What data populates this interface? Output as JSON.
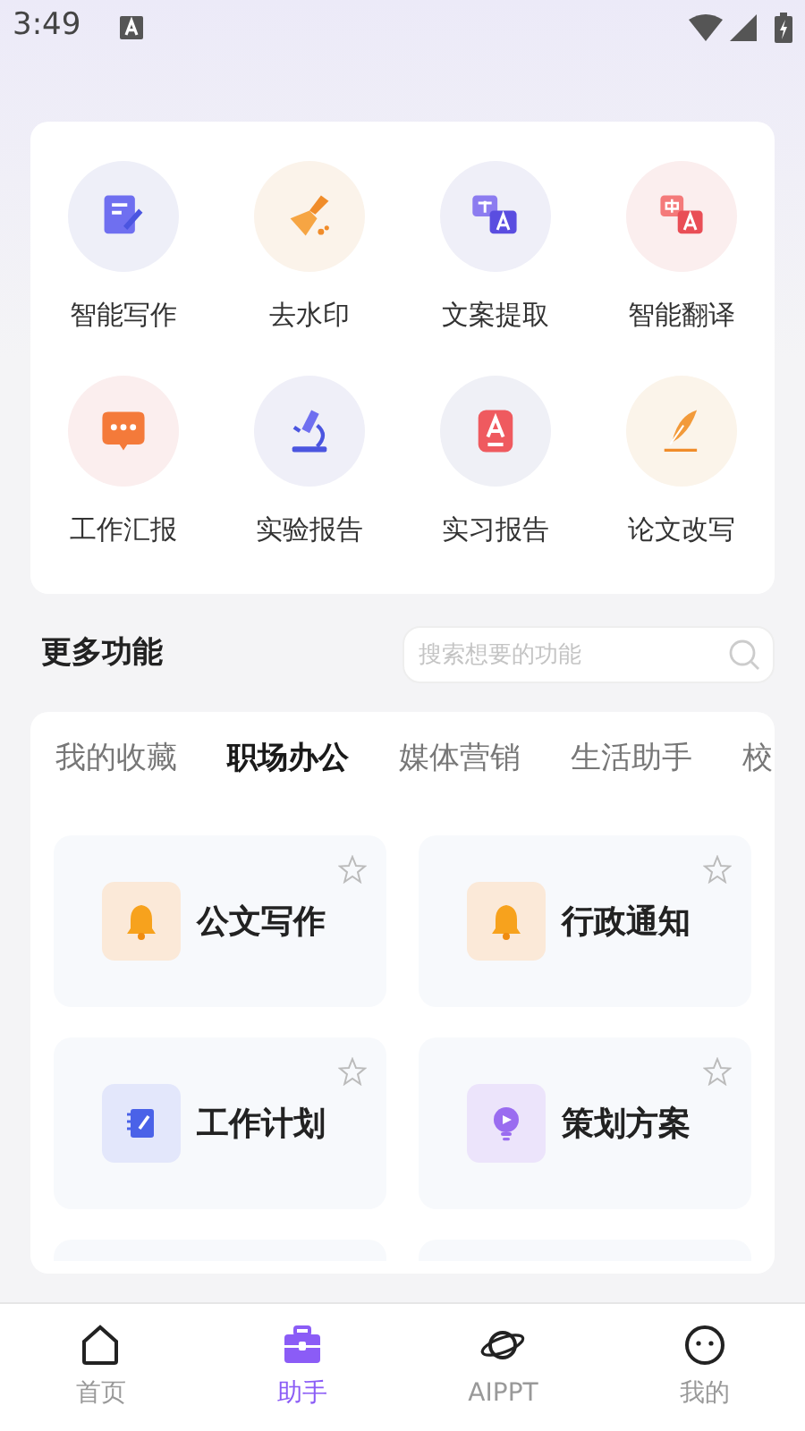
{
  "status_bar": {
    "time": "3:49"
  },
  "quick_tools": [
    {
      "label": "智能写作"
    },
    {
      "label": "去水印"
    },
    {
      "label": "文案提取"
    },
    {
      "label": "智能翻译"
    },
    {
      "label": "工作汇报"
    },
    {
      "label": "实验报告"
    },
    {
      "label": "实习报告"
    },
    {
      "label": "论文改写"
    }
  ],
  "more_section": {
    "title": "更多功能",
    "search": {
      "placeholder": "搜索想要的功能"
    }
  },
  "category_tabs": [
    {
      "label": "我的收藏",
      "selected": false
    },
    {
      "label": "职场办公",
      "selected": true
    },
    {
      "label": "媒体营销",
      "selected": false
    },
    {
      "label": "生活助手",
      "selected": false
    },
    {
      "label": "校",
      "selected": false
    }
  ],
  "tool_cards": [
    {
      "label": "公文写作",
      "favorite": false
    },
    {
      "label": "行政通知",
      "favorite": false
    },
    {
      "label": "工作计划",
      "favorite": false
    },
    {
      "label": "策划方案",
      "favorite": false
    }
  ],
  "bottom_nav": [
    {
      "label": "首页",
      "selected": false
    },
    {
      "label": "助手",
      "selected": true
    },
    {
      "label": "AIPPT",
      "selected": false
    },
    {
      "label": "我的",
      "selected": false
    }
  ]
}
